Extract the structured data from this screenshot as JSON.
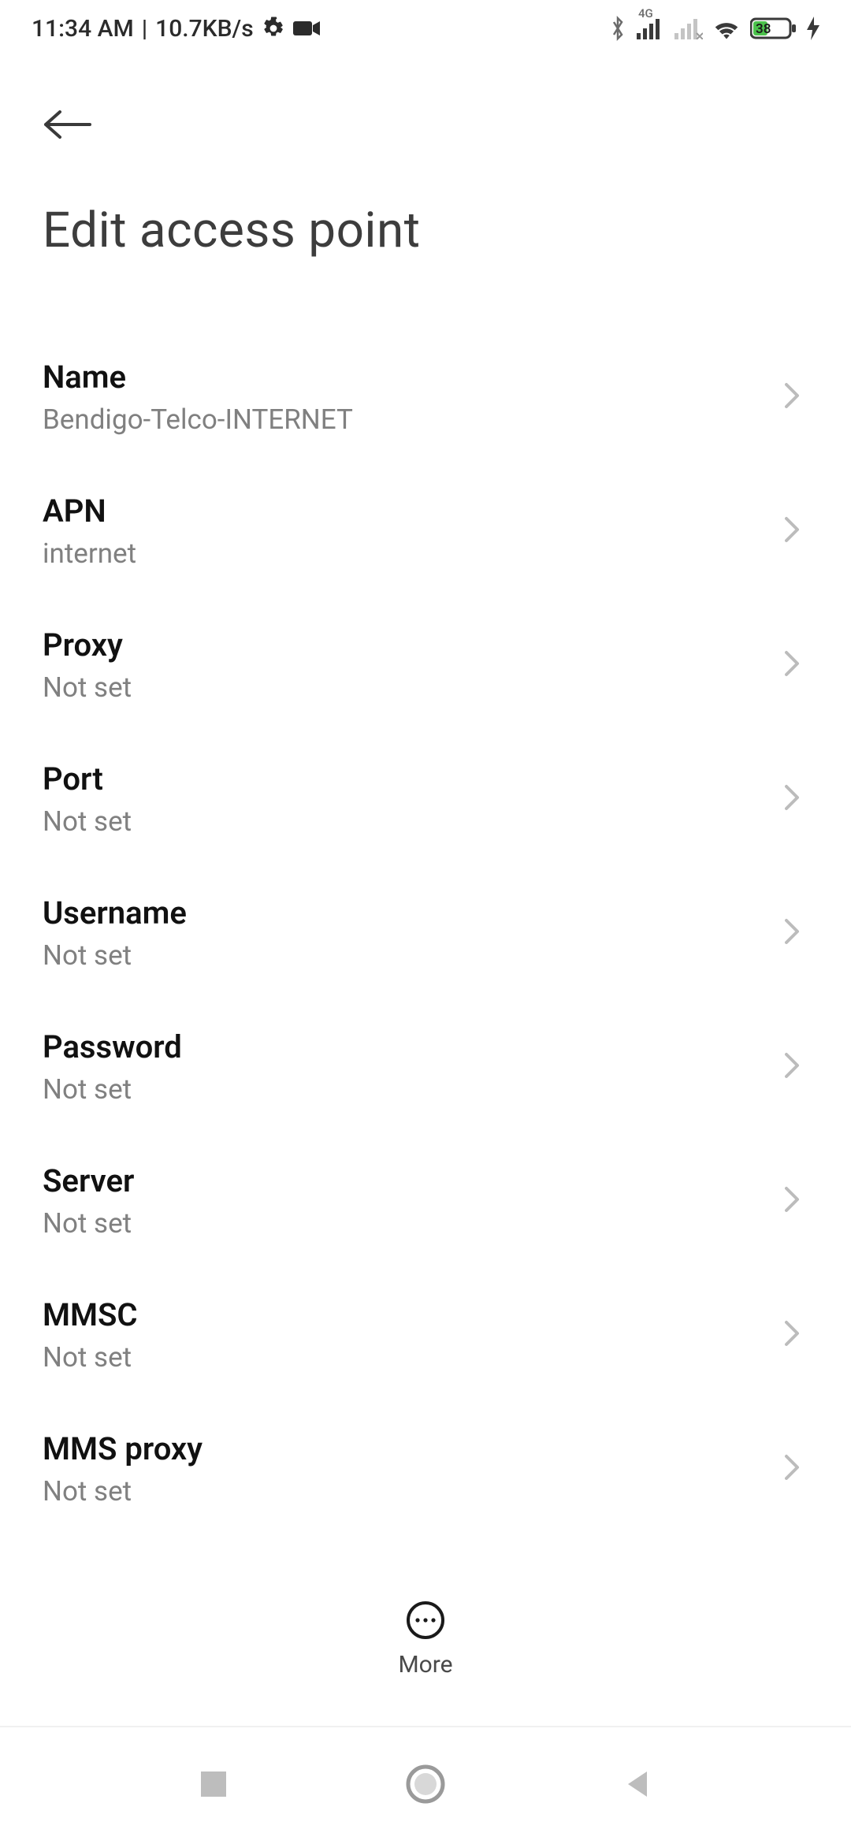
{
  "status_bar": {
    "time": "11:34 AM",
    "separator": "|",
    "net_speed": "10.7KB/s",
    "battery_percent": "38",
    "icons": {
      "settings": "gear-icon",
      "camera": "camera-icon",
      "bluetooth": "bluetooth-icon",
      "mobile_4g": "4G",
      "signal_sim1": "signal-full-icon",
      "signal_sim2": "signal-none-icon",
      "wifi": "wifi-icon",
      "battery": "battery-icon",
      "charging": "charging-icon"
    }
  },
  "header": {
    "back": "back",
    "title": "Edit access point"
  },
  "settings": [
    {
      "label": "Name",
      "value": "Bendigo-Telco-INTERNET"
    },
    {
      "label": "APN",
      "value": "internet"
    },
    {
      "label": "Proxy",
      "value": "Not set"
    },
    {
      "label": "Port",
      "value": "Not set"
    },
    {
      "label": "Username",
      "value": "Not set"
    },
    {
      "label": "Password",
      "value": "Not set"
    },
    {
      "label": "Server",
      "value": "Not set"
    },
    {
      "label": "MMSC",
      "value": "Not set"
    },
    {
      "label": "MMS proxy",
      "value": "Not set"
    }
  ],
  "footer": {
    "more_label": "More"
  },
  "system_nav": {
    "recents": "recents",
    "home": "home",
    "back": "back"
  }
}
